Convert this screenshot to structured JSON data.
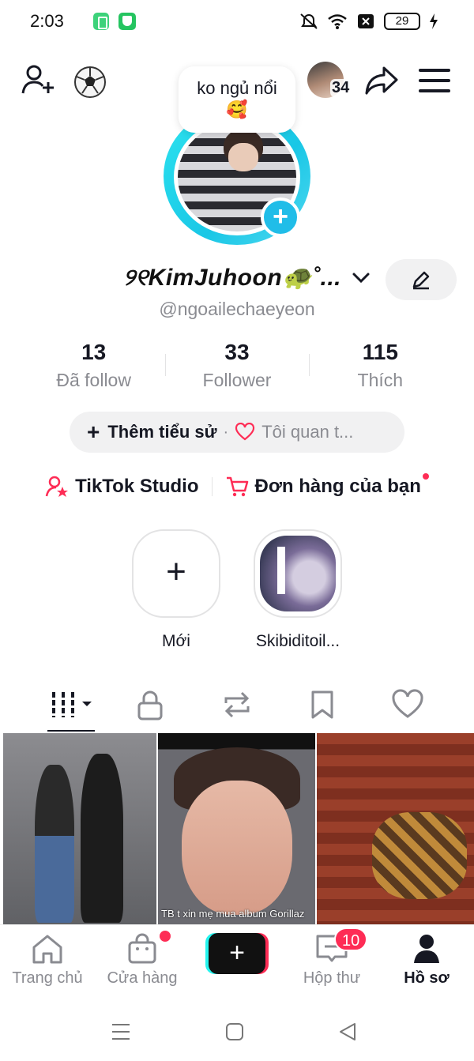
{
  "status_bar": {
    "time": "2:03",
    "battery": "29"
  },
  "header": {
    "bubble_text": "ko ngủ nổi",
    "bubble_emoji": "🥰",
    "avatar_count": "34"
  },
  "profile": {
    "display_name": "୨୧KimJuhoon🐢˚...",
    "username": "@ngoailechaeyeon"
  },
  "stats": [
    {
      "value": "13",
      "label": "Đã follow"
    },
    {
      "value": "33",
      "label": "Follower"
    },
    {
      "value": "115",
      "label": "Thích"
    }
  ],
  "bio": {
    "add_label": "Thêm tiểu sử",
    "separator": "·",
    "interest_label": "Tôi quan t..."
  },
  "links": {
    "studio": "TikTok Studio",
    "orders": "Đơn hàng của bạn"
  },
  "highlights": [
    {
      "label": "Mới"
    },
    {
      "label": "Skibiditoil..."
    }
  ],
  "videos": [
    {
      "caption": ""
    },
    {
      "caption": "TB t xin mẹ mua album Gorillaz"
    },
    {
      "caption": ""
    }
  ],
  "bottom_nav": {
    "home": "Trang chủ",
    "shop": "Cửa hàng",
    "inbox": "Hộp thư",
    "inbox_badge": "10",
    "profile": "Hồ sơ"
  },
  "colors": {
    "accent_red": "#fe2c55",
    "accent_cyan": "#25f4ee",
    "ring": "#19c7e6"
  }
}
